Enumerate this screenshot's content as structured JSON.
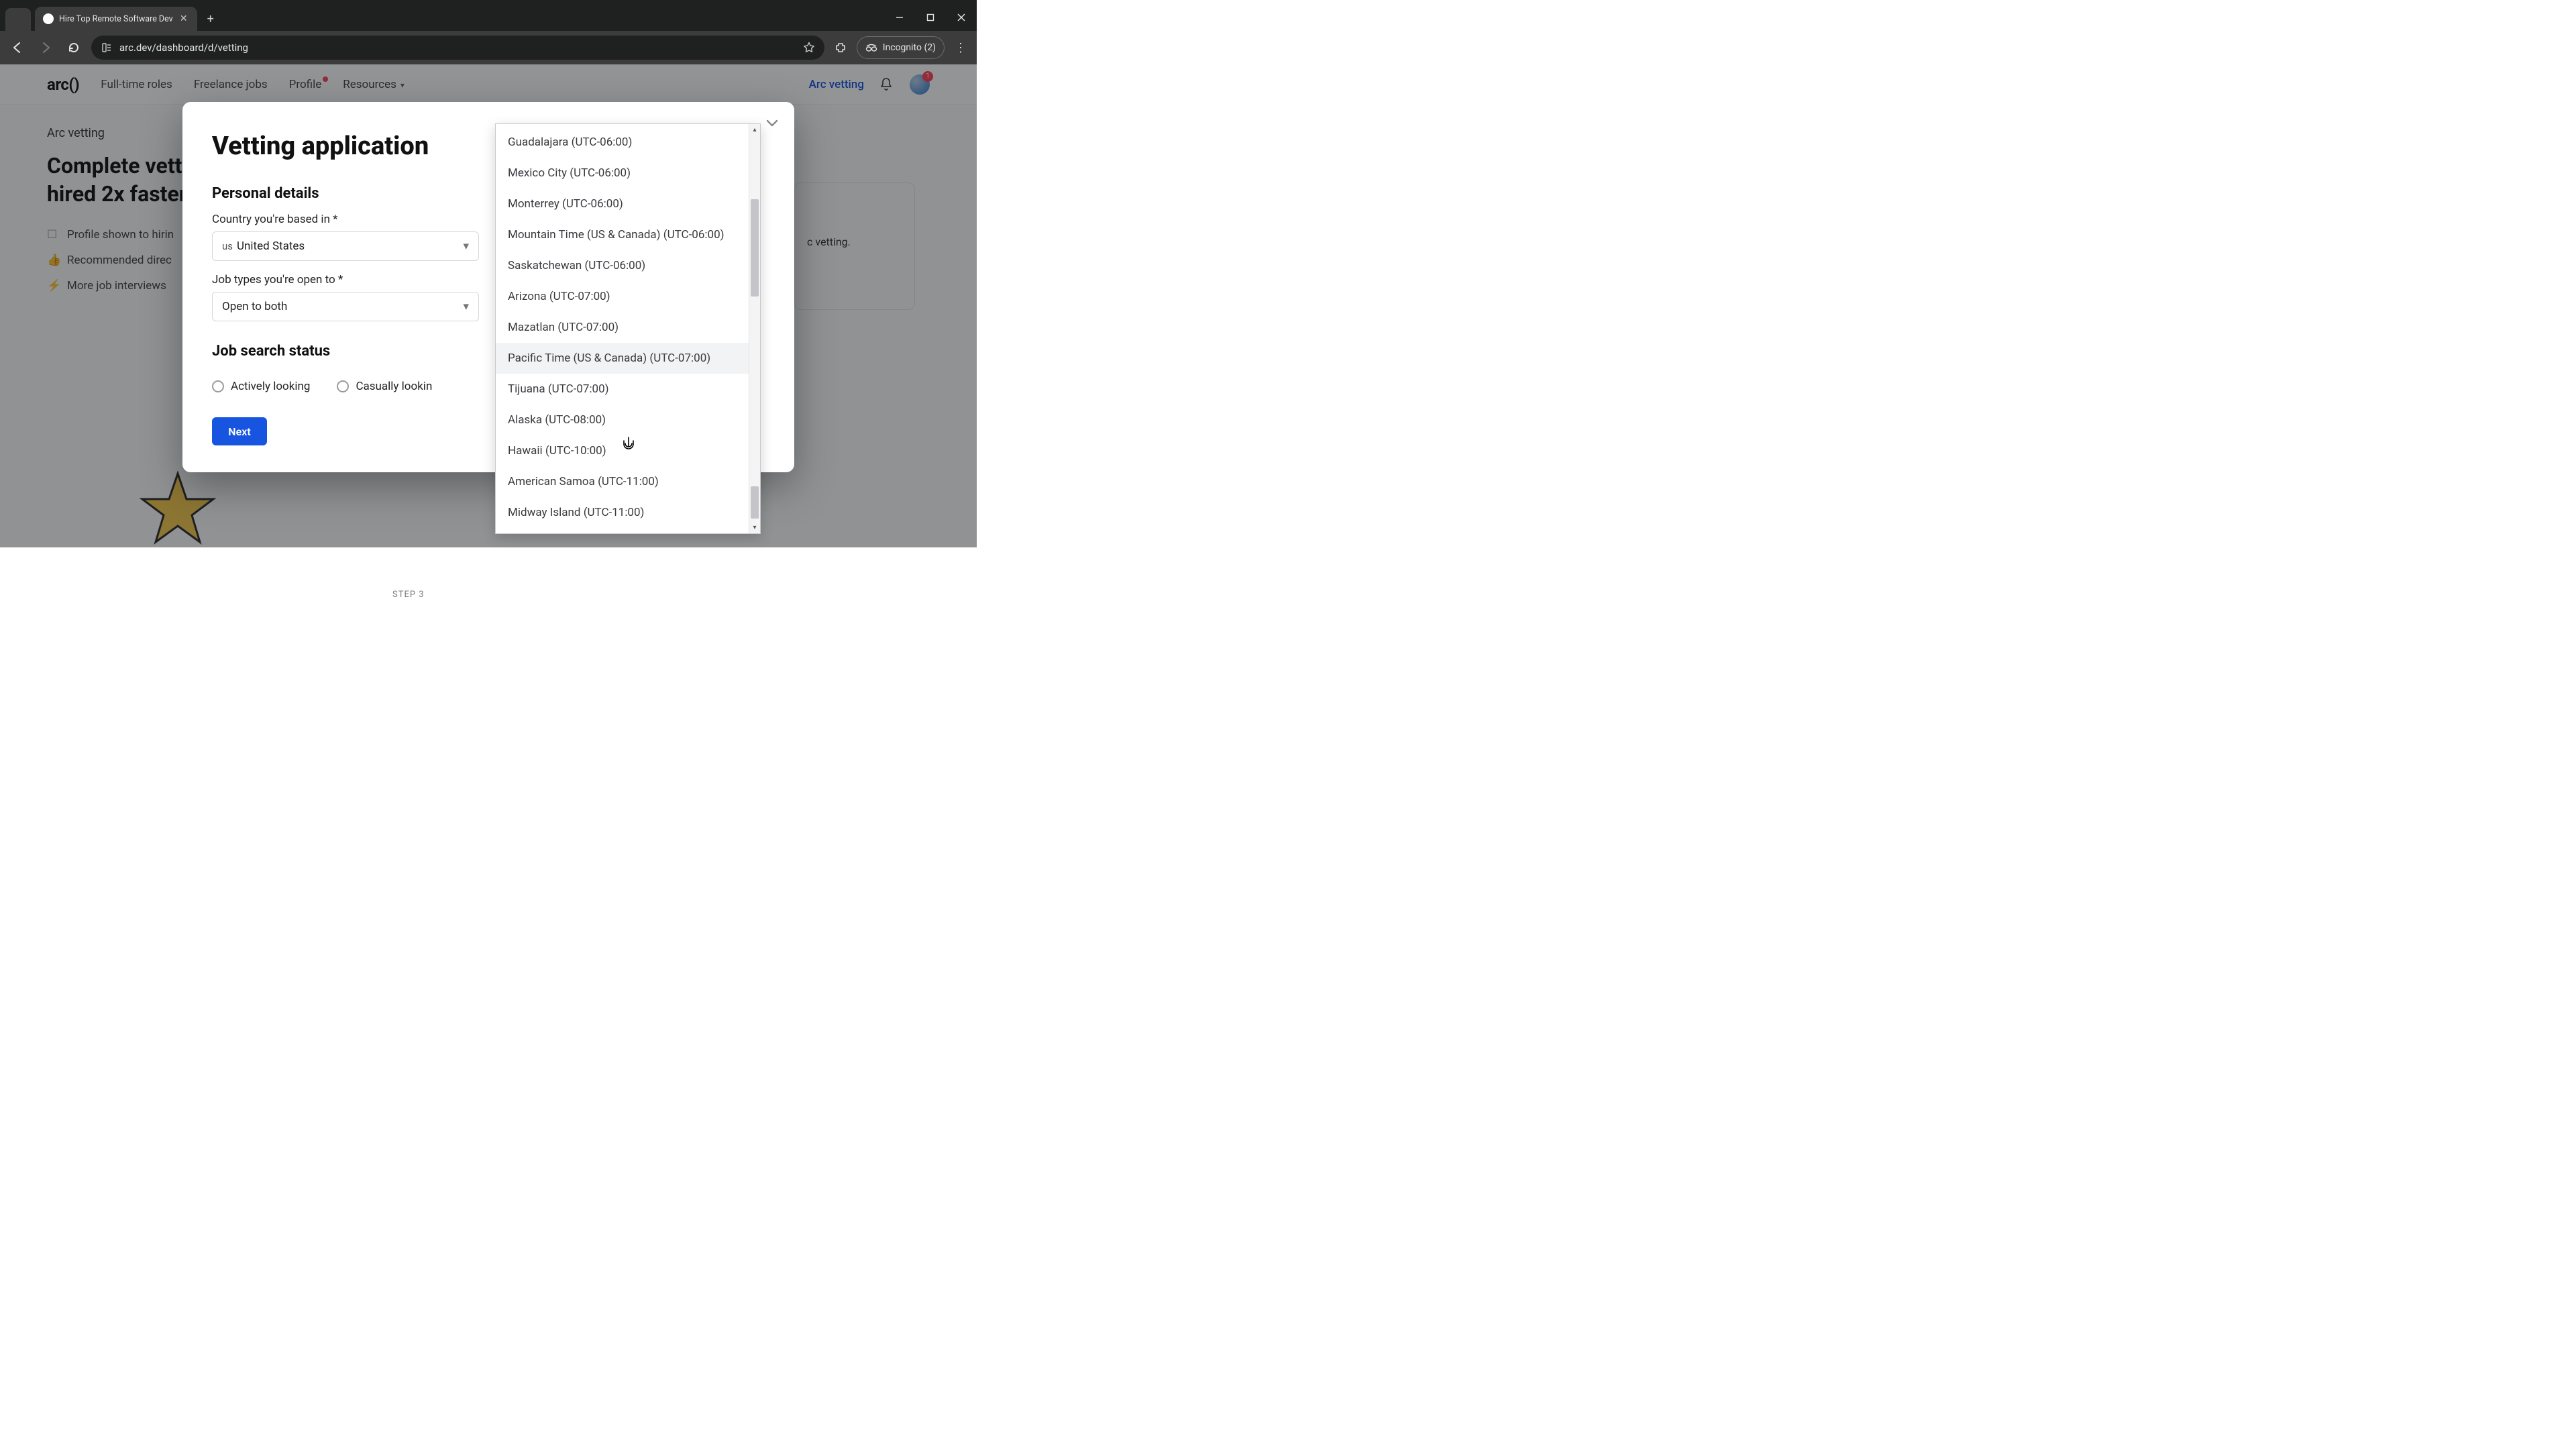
{
  "browser": {
    "tab_title": "Hire Top Remote Software Dev",
    "url": "arc.dev/dashboard/d/vetting",
    "incognito_label": "Incognito (2)"
  },
  "header": {
    "logo": "arc()",
    "nav": {
      "full_time": "Full-time roles",
      "freelance": "Freelance jobs",
      "profile": "Profile",
      "resources": "Resources"
    },
    "vetting_link": "Arc vetting",
    "avatar_badge": "1"
  },
  "page": {
    "crumb": "Arc vetting",
    "headline_a": "Complete vetti",
    "headline_b": "hired 2x faster",
    "benefits": {
      "b1": "Profile shown to hirin",
      "b2": "Recommended direc",
      "b3": "More job interviews"
    },
    "step_indicator": "STEP 3",
    "side_text": "c vetting."
  },
  "modal": {
    "title": "Vetting application",
    "section1": "Personal details",
    "country_label": "Country you're based in *",
    "country_value": "United States",
    "country_flagcode": "us",
    "jobtypes_label": "Job types you're open to *",
    "jobtypes_value": "Open to both",
    "section2": "Job search status",
    "radio1": "Actively looking",
    "radio2": "Casually lookin",
    "next": "Next"
  },
  "dropdown": {
    "items": [
      "Guadalajara (UTC-06:00)",
      "Mexico City (UTC-06:00)",
      "Monterrey (UTC-06:00)",
      "Mountain Time (US & Canada) (UTC-06:00)",
      "Saskatchewan (UTC-06:00)",
      "Arizona (UTC-07:00)",
      "Mazatlan (UTC-07:00)",
      "Pacific Time (US & Canada) (UTC-07:00)",
      "Tijuana (UTC-07:00)",
      "Alaska (UTC-08:00)",
      "Hawaii (UTC-10:00)",
      "American Samoa (UTC-11:00)",
      "Midway Island (UTC-11:00)"
    ],
    "highlighted_index": 7
  }
}
